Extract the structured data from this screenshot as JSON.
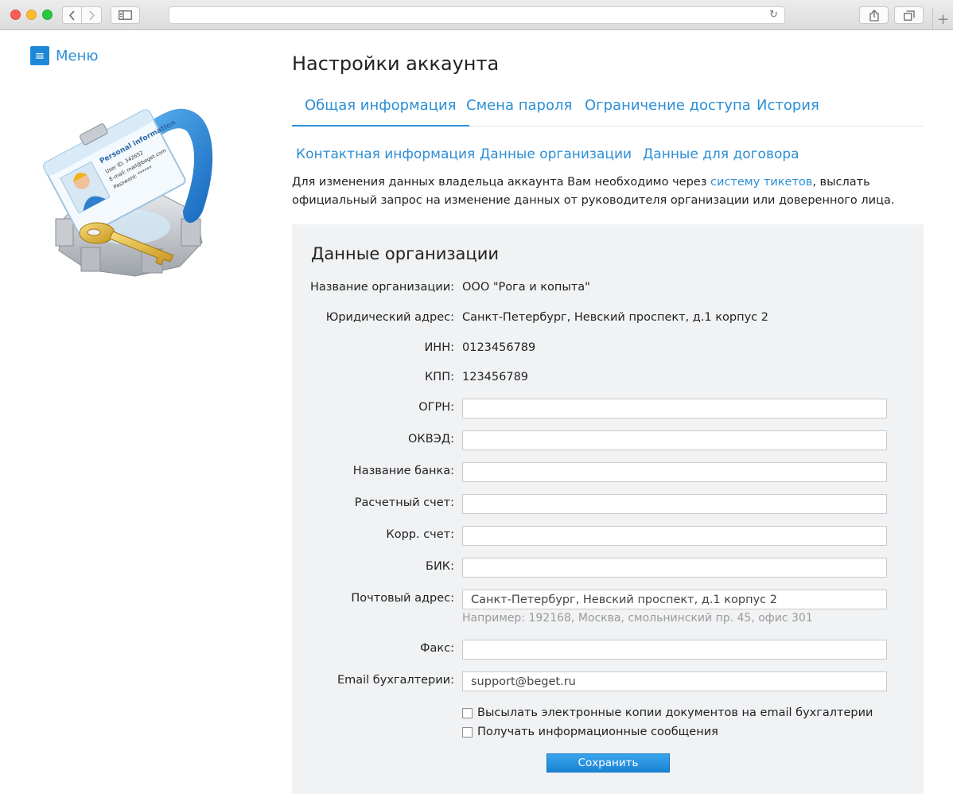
{
  "sidebar": {
    "menu_label": "Меню",
    "card": {
      "title": "Personal information",
      "user_id": "User ID: 342652",
      "email": "E-mail: mail@beget.com",
      "password": "Password: ******"
    }
  },
  "page": {
    "title": "Настройки аккаунта"
  },
  "tabs": [
    {
      "label": "Общая информация",
      "active": true
    },
    {
      "label": "Смена пароля",
      "active": false
    },
    {
      "label": "Ограничение доступа",
      "active": false
    },
    {
      "label": "История",
      "active": false
    }
  ],
  "subtabs": [
    {
      "label": "Контактная информация"
    },
    {
      "label": "Данные организации",
      "current": true
    },
    {
      "label": "Данные для договора"
    }
  ],
  "notice": {
    "before": "Для изменения данных владельца аккаунта Вам необходимо через ",
    "link": "систему тикетов",
    "after": ", выслать официальный запрос на изменение данных от руководителя организации или доверенного лица."
  },
  "form": {
    "title": "Данные организации",
    "static": [
      {
        "label": "Название организации:",
        "value": "ООО \"Рога и копыта\""
      },
      {
        "label": "Юридический адрес:",
        "value": "Санкт-Петербург, Невский проспект, д.1 корпус 2"
      },
      {
        "label": "ИНН:",
        "value": "0123456789"
      },
      {
        "label": "КПП:",
        "value": "123456789"
      }
    ],
    "fields": [
      {
        "label": "ОГРН:",
        "value": ""
      },
      {
        "label": "ОКВЭД:",
        "value": ""
      },
      {
        "label": "Название банка:",
        "value": ""
      },
      {
        "label": "Расчетный счет:",
        "value": ""
      },
      {
        "label": "Корр. счет:",
        "value": ""
      },
      {
        "label": "БИК:",
        "value": ""
      }
    ],
    "postal": {
      "label": "Почтовый адрес:",
      "value": "Санкт-Петербург, Невский проспект, д.1 корпус 2",
      "hint": "Например: 192168, Москва, смольнинский пр. 45, офис 301"
    },
    "fax": {
      "label": "Факс:",
      "value": ""
    },
    "email": {
      "label": "Email бухгалтерии:",
      "value": "support@beget.ru"
    },
    "checkboxes": [
      {
        "label": "Высылать электронные копии документов на email бухгалтерии",
        "checked": false
      },
      {
        "label": "Получать информационные сообщения",
        "checked": false
      }
    ],
    "save_label": "Сохранить"
  }
}
